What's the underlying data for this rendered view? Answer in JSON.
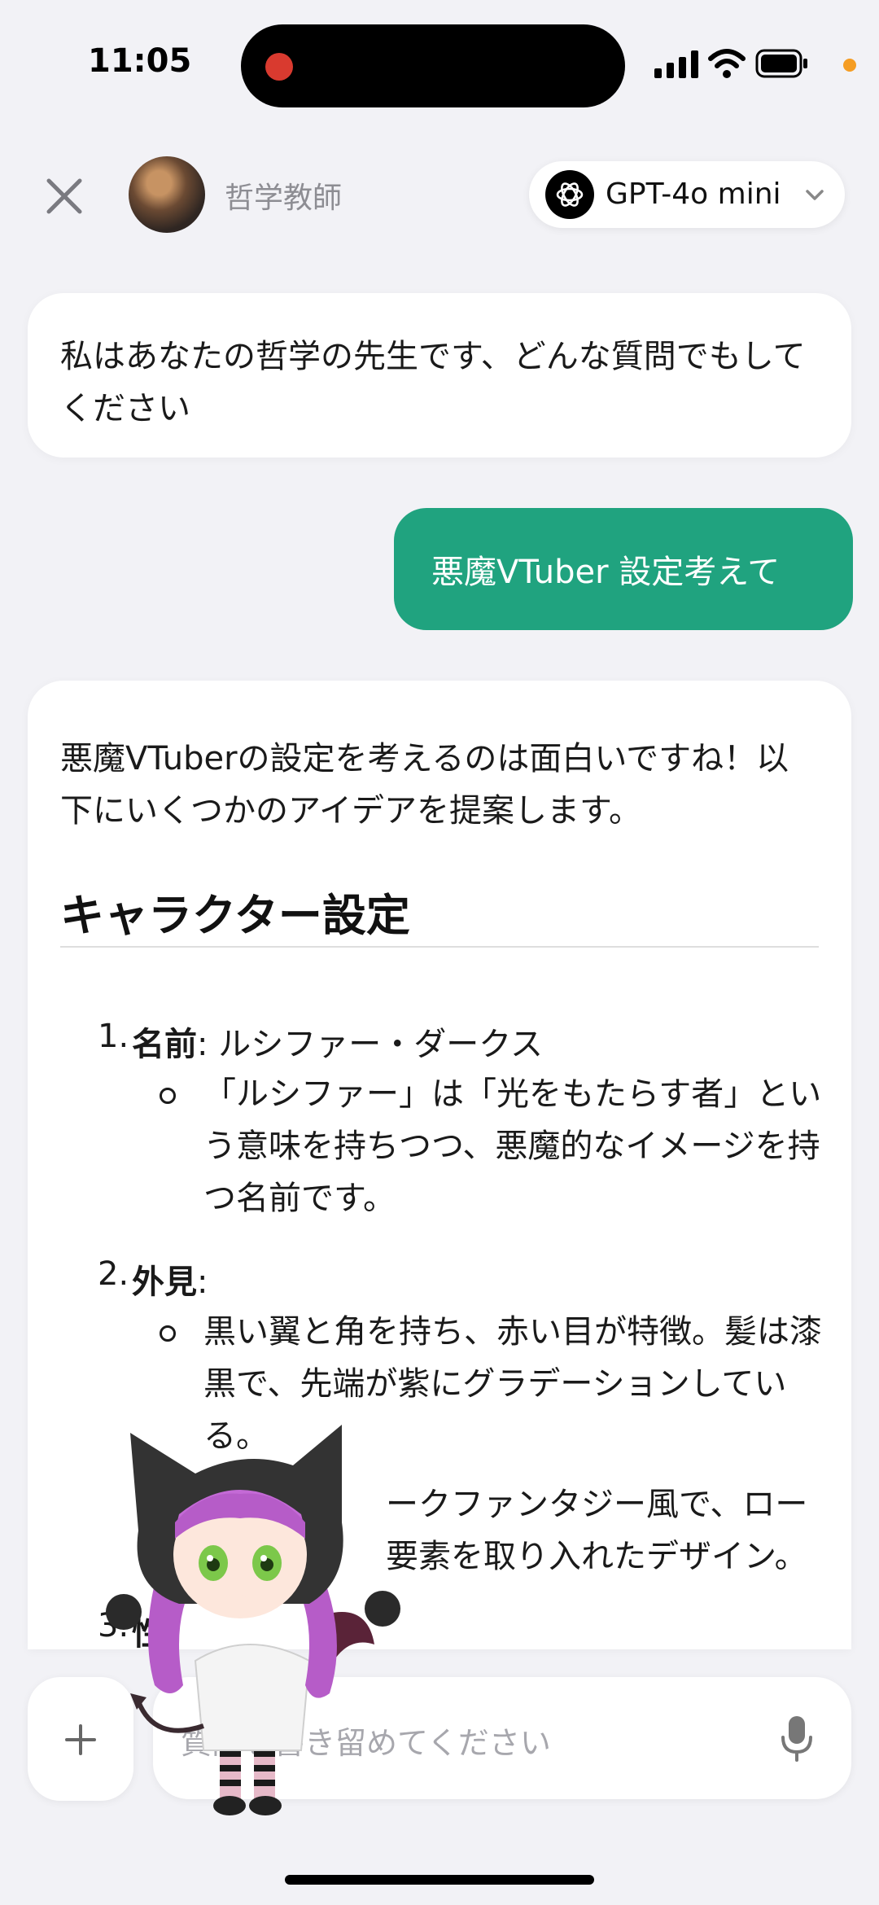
{
  "status_bar": {
    "time": "11:05",
    "icons": [
      "recording-dot",
      "cellular-signal",
      "wifi",
      "battery",
      "privacy-dot"
    ]
  },
  "header": {
    "persona_name": "哲学教師",
    "model_label": "GPT-4o mini",
    "icons": [
      "close-icon",
      "openai-logo-icon",
      "chevron-down-icon"
    ]
  },
  "messages": {
    "greeting": "私はあなたの哲学の先生です、どんな質問でもしてください",
    "user": "悪魔VTuber 設定考えて",
    "reply": {
      "intro": "悪魔VTuberの設定を考えるのは面白いですね！以下にいくつかのアイデアを提案します。",
      "heading": "キャラクター設定",
      "items": [
        {
          "number": "1.",
          "label": "名前",
          "value": ": ルシファー・ダークス",
          "bullets": [
            "「ルシファー」は「光をもたらす者」という意味を持ちつつ、悪魔的なイメージを持つ名前です。"
          ]
        },
        {
          "number": "2.",
          "label": "外見",
          "value": ":",
          "bullets": [
            "黒い翼と角を持ち、赤い目が特徴。髪は漆黒で、先端が紫にグラデーションしている。",
            "ークファンタジー風で、ロー",
            "要素を取り入れたデザイン。"
          ]
        },
        {
          "number": "3.",
          "label": "性"
        }
      ]
    }
  },
  "input": {
    "placeholder": "質問を書き留めてください",
    "icons": [
      "plus-icon",
      "microphone-icon"
    ]
  },
  "colors": {
    "accent": "#20a37f",
    "background": "#f2f2f6",
    "recording": "#d93a2f",
    "privacy_dot": "#f59d23"
  }
}
